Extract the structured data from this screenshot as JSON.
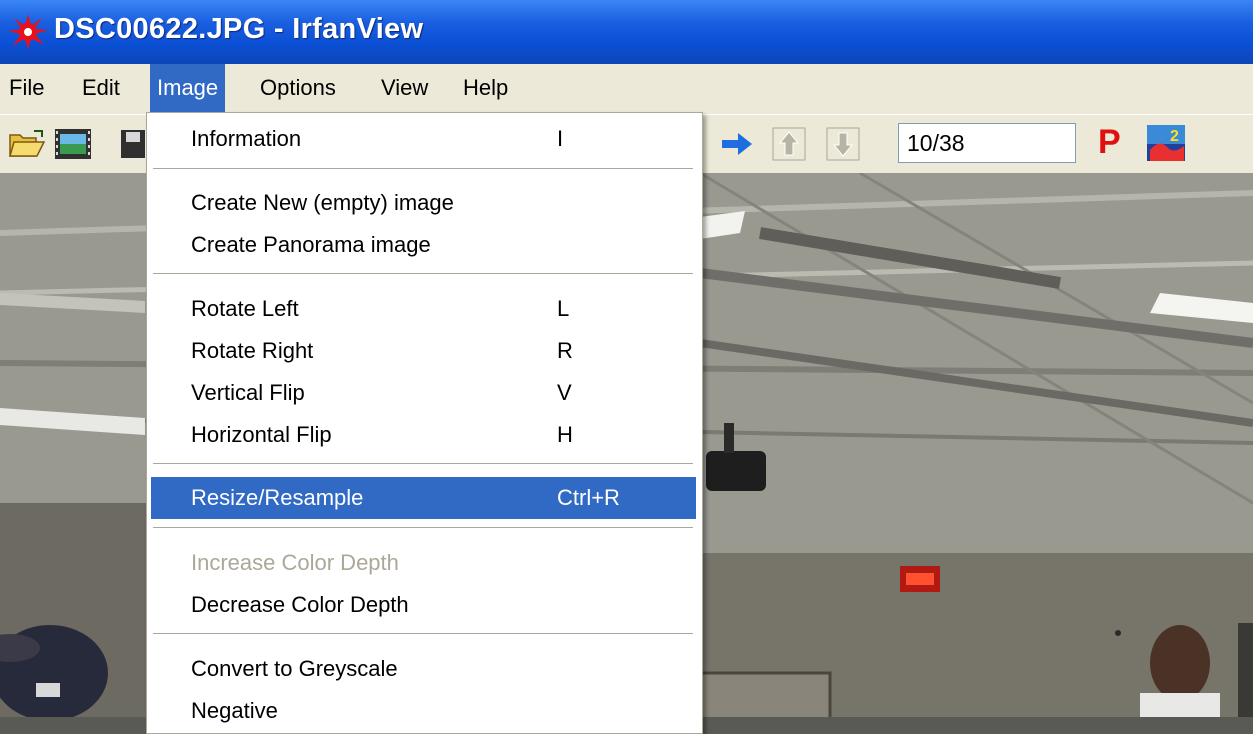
{
  "window": {
    "title": "DSC00622.JPG - IrfanView",
    "app_icon": "irfanview-logo-icon"
  },
  "menubar": {
    "items": [
      "File",
      "Edit",
      "Image",
      "Options",
      "View",
      "Help"
    ],
    "active": "Image"
  },
  "toolbar": {
    "icons": [
      "open-folder-icon",
      "slideshow-icon",
      "save-icon",
      "next-arrow-icon",
      "up-arrow-icon",
      "down-arrow-icon",
      "paint-p-icon",
      "irfanview-icon"
    ],
    "counter": "10/38",
    "p_label": "P"
  },
  "image_menu": {
    "items": [
      {
        "label": "Information",
        "shortcut": "I"
      },
      {
        "label": "Create New (empty) image",
        "shortcut": ""
      },
      {
        "label": "Create Panorama image",
        "shortcut": ""
      },
      {
        "label": "Rotate Left",
        "shortcut": "L"
      },
      {
        "label": "Rotate Right",
        "shortcut": "R"
      },
      {
        "label": "Vertical Flip",
        "shortcut": "V"
      },
      {
        "label": "Horizontal Flip",
        "shortcut": "H"
      },
      {
        "label": "Resize/Resample",
        "shortcut": "Ctrl+R"
      },
      {
        "label": "Increase Color Depth",
        "shortcut": ""
      },
      {
        "label": "Decrease Color Depth",
        "shortcut": ""
      },
      {
        "label": "Convert to Greyscale",
        "shortcut": ""
      },
      {
        "label": "Negative",
        "shortcut": ""
      }
    ],
    "highlighted": "Resize/Resample",
    "disabled": [
      "Increase Color Depth"
    ]
  },
  "colors": {
    "titlebar": "#0a4fd4",
    "menu_highlight": "#316ac5",
    "menu_bg": "#ece9d8"
  }
}
